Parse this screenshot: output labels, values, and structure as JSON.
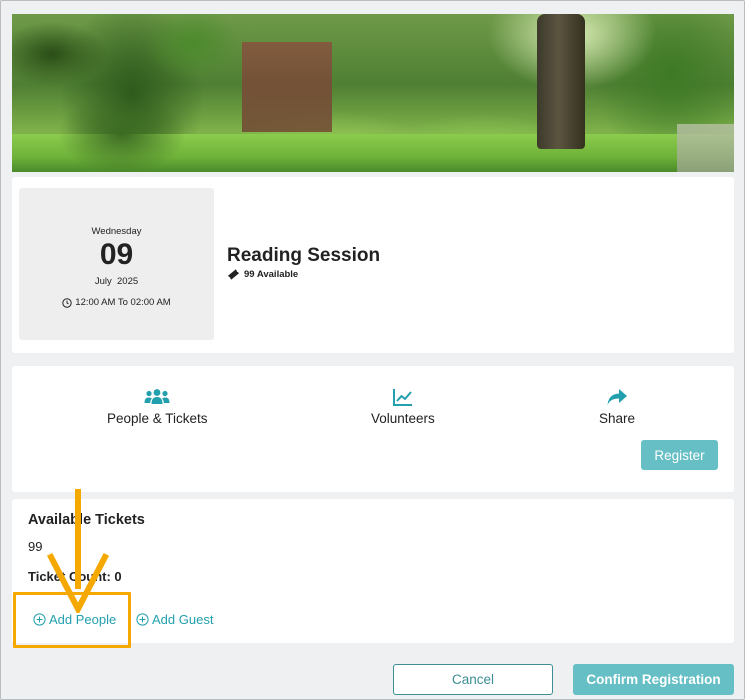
{
  "event": {
    "weekday": "Wednesday",
    "day": "09",
    "month_year": "July  2025",
    "time": "12:00 AM To 02:00 AM",
    "title": "Reading Session",
    "available": "99 Available"
  },
  "actions": {
    "people_tickets": "People & Tickets",
    "volunteers": "Volunteers",
    "share": "Share",
    "register": "Register"
  },
  "tickets": {
    "title": "Available Tickets",
    "count": "99",
    "ticket_count": "Ticket Count: 0",
    "add_people": "Add People",
    "add_guest": "Add Guest"
  },
  "footer": {
    "cancel": "Cancel",
    "confirm": "Confirm Registration"
  },
  "colors": {
    "accent": "#23a0ad",
    "button": "#65bfc5",
    "highlight": "#f5a800"
  },
  "icons": {
    "people": "users-icon",
    "volunteers": "chart-line-icon",
    "share": "share-arrow-icon",
    "ticket": "ticket-icon",
    "clock": "clock-icon",
    "add": "plus-circle-icon"
  }
}
